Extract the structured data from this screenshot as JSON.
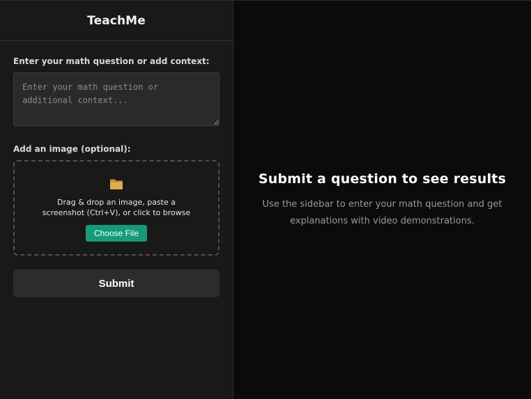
{
  "app": {
    "title": "TeachMe"
  },
  "form": {
    "question_label": "Enter your math question or add context:",
    "question_placeholder": "Enter your math question or additional context...",
    "question_value": "",
    "image_label": "Add an image (optional):",
    "dropzone": {
      "icon": "folder-icon",
      "text": "Drag & drop an image, paste a screenshot (Ctrl+V), or click to browse",
      "button_label": "Choose File"
    },
    "submit_label": "Submit"
  },
  "main": {
    "heading": "Submit a question to see results",
    "description": "Use the sidebar to enter your math question and get explanations with video demonstrations."
  },
  "colors": {
    "sidebar_bg": "#191919",
    "main_bg": "#0b0b0b",
    "accent": "#149b7a",
    "folder": "#d9a441"
  }
}
